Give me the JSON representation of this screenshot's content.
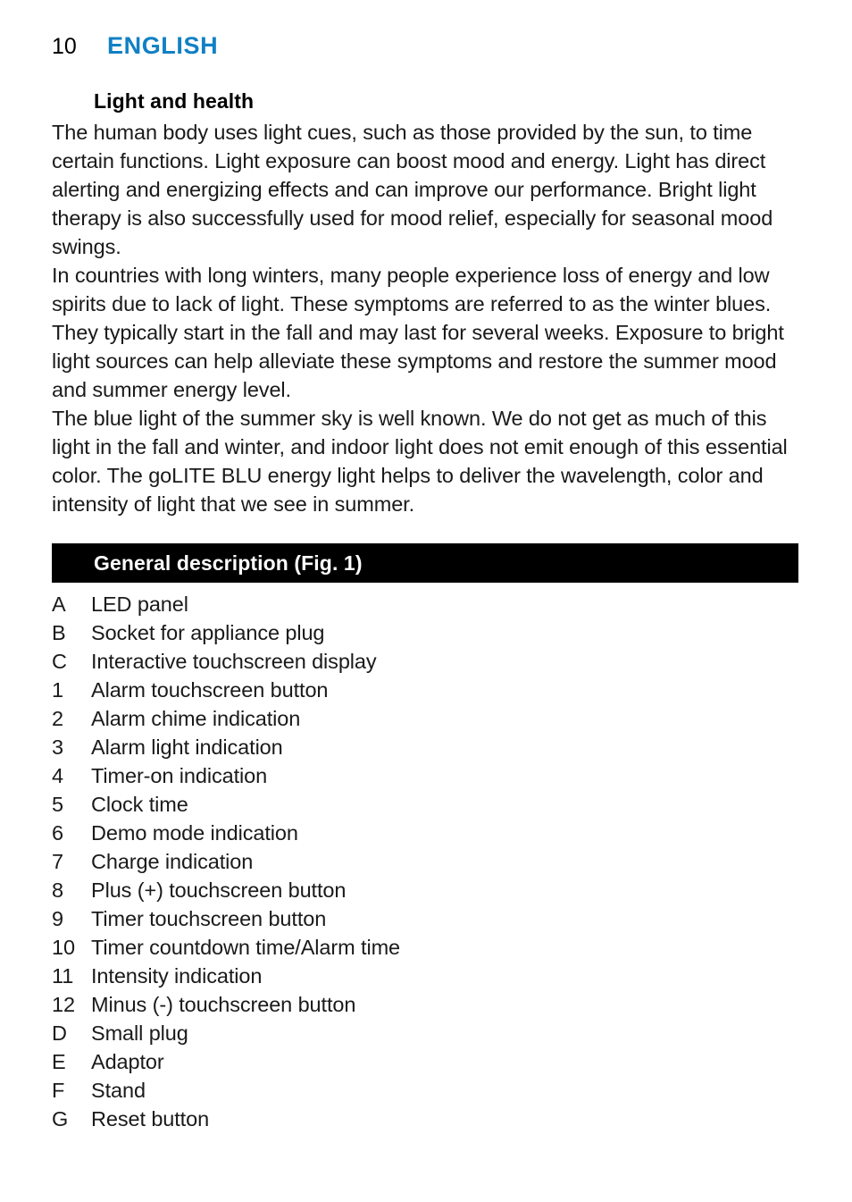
{
  "header": {
    "page_number": "10",
    "chapter_title": "ENGLISH",
    "accent_color": "#1180c4"
  },
  "content": {
    "subheading": "Light and health",
    "paragraphs": [
      "The human body uses light cues, such as those provided by the sun, to time certain functions. Light exposure can boost mood and energy. Light has direct alerting and energizing effects and can improve our performance. Bright light therapy is also successfully used for mood relief, especially for seasonal mood swings.",
      "In countries with long winters, many people experience loss of energy and low spirits due to lack of light. These symptoms are referred to as the winter blues. They typically start in the fall and may last for several weeks. Exposure to bright light sources can help alleviate these symptoms and restore the summer mood and summer energy level.",
      "The blue light of the summer sky is well known. We do not get as much of this light in the fall and winter, and indoor light does not emit enough of this essential color. The goLITE BLU energy light helps to deliver the wavelength, color and intensity of light that we see in summer."
    ]
  },
  "section": {
    "banner_label": "General description (Fig. 1)",
    "banner_bg_color": "#000000",
    "banner_text_color": "#ffffff"
  },
  "parts_list": [
    {
      "marker": "A",
      "label": "LED panel"
    },
    {
      "marker": "B",
      "label": "Socket for appliance plug"
    },
    {
      "marker": "C",
      "label": "Interactive touchscreen display"
    },
    {
      "marker": "1",
      "label": "Alarm touchscreen button"
    },
    {
      "marker": "2",
      "label": "Alarm chime indication"
    },
    {
      "marker": "3",
      "label": "Alarm light indication"
    },
    {
      "marker": "4",
      "label": "Timer-on indication"
    },
    {
      "marker": "5",
      "label": "Clock time"
    },
    {
      "marker": "6",
      "label": "Demo mode indication"
    },
    {
      "marker": "7",
      "label": "Charge indication"
    },
    {
      "marker": "8",
      "label": "Plus (+) touchscreen button"
    },
    {
      "marker": "9",
      "label": "Timer touchscreen button"
    },
    {
      "marker": "10",
      "label": "Timer countdown time/Alarm time"
    },
    {
      "marker": "11",
      "label": "Intensity indication"
    },
    {
      "marker": "12",
      "label": "Minus (-) touchscreen button"
    },
    {
      "marker": "D",
      "label": "Small plug"
    },
    {
      "marker": "E",
      "label": "Adaptor"
    },
    {
      "marker": "F",
      "label": "Stand"
    },
    {
      "marker": "G",
      "label": "Reset button"
    }
  ]
}
